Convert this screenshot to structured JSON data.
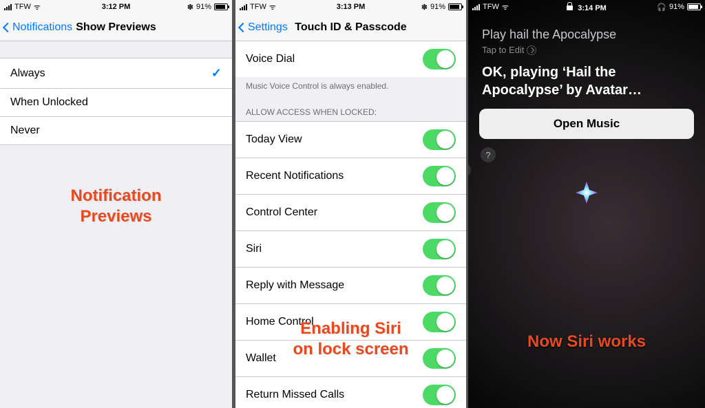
{
  "phone1": {
    "status": {
      "carrier": "TFW",
      "time": "3:12 PM",
      "battery": "91%",
      "bt": "✽"
    },
    "nav": {
      "back": "Notifications",
      "title": "Show Previews"
    },
    "options": [
      {
        "label": "Always",
        "selected": true
      },
      {
        "label": "When Unlocked",
        "selected": false
      },
      {
        "label": "Never",
        "selected": false
      }
    ],
    "caption_line1": "Notification",
    "caption_line2": "Previews"
  },
  "phone2": {
    "status": {
      "carrier": "TFW",
      "time": "3:13 PM",
      "battery": "91%",
      "bt": "✽"
    },
    "nav": {
      "back": "Settings",
      "title": "Touch ID & Passcode"
    },
    "voice_dial": {
      "label": "Voice Dial",
      "on": true
    },
    "voice_footer": "Music Voice Control is always enabled.",
    "section_header": "ALLOW ACCESS WHEN LOCKED:",
    "access_items": [
      {
        "label": "Today View",
        "on": true
      },
      {
        "label": "Recent Notifications",
        "on": true
      },
      {
        "label": "Control Center",
        "on": true
      },
      {
        "label": "Siri",
        "on": true
      },
      {
        "label": "Reply with Message",
        "on": true
      },
      {
        "label": "Home Control",
        "on": true
      },
      {
        "label": "Wallet",
        "on": true
      },
      {
        "label": "Return Missed Calls",
        "on": true
      }
    ],
    "caption_line1": "Enabling Siri",
    "caption_line2": "on lock screen"
  },
  "phone3": {
    "status": {
      "carrier": "TFW",
      "time": "3:14 PM",
      "battery": "91%"
    },
    "query": "Play hail the Apocalypse",
    "tap_to_edit": "Tap to Edit",
    "response": "OK, playing ‘Hail the Apocalypse’ by Avatar…",
    "button": "Open Music",
    "help": "?",
    "caption": "Now Siri works"
  }
}
